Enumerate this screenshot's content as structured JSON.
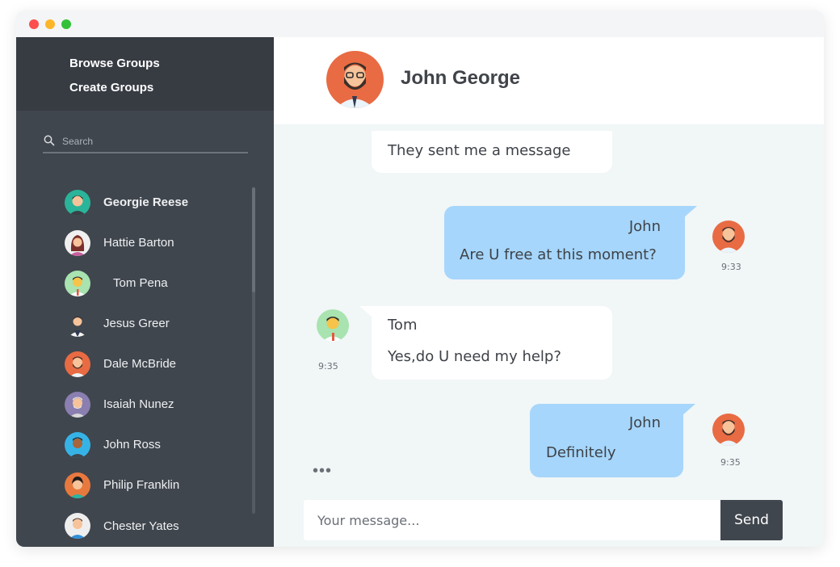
{
  "window": {
    "controls": [
      "close",
      "minimize",
      "maximize"
    ]
  },
  "sidebar": {
    "links": [
      {
        "label": "Browse Groups"
      },
      {
        "label": "Create Groups"
      }
    ],
    "search": {
      "placeholder": "Search",
      "value": ""
    },
    "contacts": [
      {
        "name": "Georgie Reese",
        "avatar": "avatar-teal-male",
        "active": true
      },
      {
        "name": "Hattie Barton",
        "avatar": "avatar-female",
        "active": false
      },
      {
        "name": "Tom Pena",
        "avatar": "avatar-green-male",
        "active": false
      },
      {
        "name": "Jesus Greer",
        "avatar": "avatar-suit-male",
        "active": false
      },
      {
        "name": "Dale McBride",
        "avatar": "avatar-bearded-male",
        "active": false
      },
      {
        "name": "Isaiah Nunez",
        "avatar": "avatar-grey-male",
        "active": false
      },
      {
        "name": "John Ross",
        "avatar": "avatar-blue-male",
        "active": false
      },
      {
        "name": "Philip Franklin",
        "avatar": "avatar-orange-female",
        "active": false
      },
      {
        "name": "Chester Yates",
        "avatar": "avatar-white-male",
        "active": false
      }
    ]
  },
  "chat": {
    "header_name": "John George",
    "messages": [
      {
        "direction": "in",
        "sender": "",
        "text": "They sent me  a  message",
        "time": ""
      },
      {
        "direction": "out",
        "sender": "John",
        "text": "Are U free at this moment?",
        "time": "9:33"
      },
      {
        "direction": "in",
        "sender": "Tom",
        "text": "Yes,do U need  my help?",
        "time": "9:35"
      },
      {
        "direction": "out",
        "sender": "John",
        "text": "Definitely",
        "time": "9:35"
      }
    ],
    "typing_indicator": "•••",
    "composer": {
      "placeholder": "Your message...",
      "value": "",
      "send_label": "Send"
    }
  },
  "colors": {
    "sidebar_bg": "#40464e",
    "sidebar_top_bg": "#373c43",
    "chat_bg": "#f1f6f7",
    "outgoing_bubble": "#a6d6fb",
    "incoming_bubble": "#ffffff",
    "send_button": "#40464e"
  }
}
